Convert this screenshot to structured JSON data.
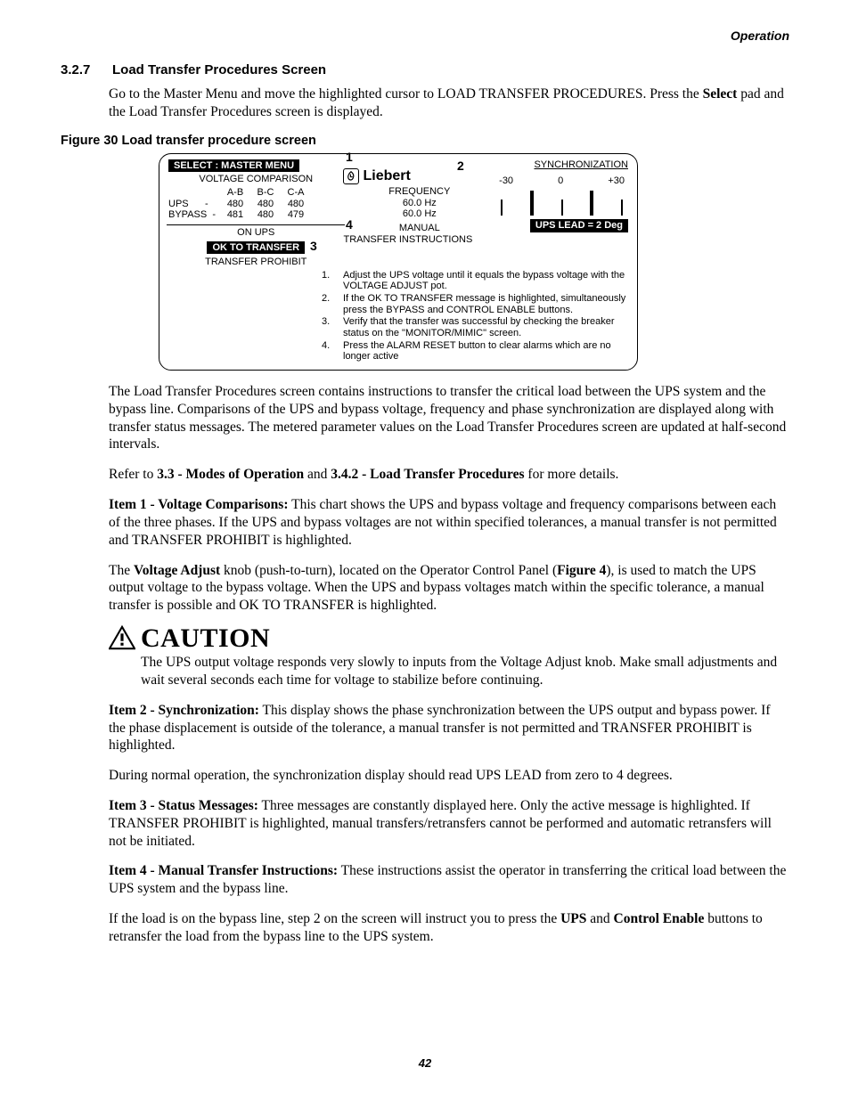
{
  "running_head": "Operation",
  "section": {
    "num": "3.2.7",
    "title": "Load Transfer Procedures Screen"
  },
  "intro": {
    "t1": "Go to the Master Menu and move the highlighted cursor to LOAD TRANSFER PROCEDURES. Press the ",
    "b1": "Select",
    "t2": " pad and the Load Transfer Procedures screen is displayed."
  },
  "fig_caption": "Figure 30  Load transfer procedure screen",
  "panel": {
    "select_bar": "SELECT  :  MASTER MENU",
    "vc_title": "VOLTAGE COMPARISON",
    "vc_headers": [
      "A-B",
      "B-C",
      "C-A"
    ],
    "vc_rows": [
      {
        "label": "UPS",
        "dash": "-",
        "vals": [
          "480",
          "480",
          "480"
        ]
      },
      {
        "label": "BYPASS",
        "dash": "-",
        "vals": [
          "481",
          "480",
          "479"
        ]
      }
    ],
    "on_ups": "ON UPS",
    "ok_transfer": "OK  TO  TRANSFER",
    "transfer_prohibit": "TRANSFER PROHIBIT",
    "logo": "Liebert",
    "freq_title": "FREQUENCY",
    "freq_vals": [
      "60.0 Hz",
      "60.0 Hz"
    ],
    "manual": "MANUAL",
    "trans_instr": "TRANSFER INSTRUCTIONS",
    "sync_title": "SYNCHRONIZATION",
    "sync_scale": [
      "-30",
      "0",
      "+30"
    ],
    "ups_lead": "UPS  LEAD    =    2 Deg",
    "instructions": [
      "Adjust the UPS voltage until it equals the bypass voltage with the VOLTAGE ADJUST pot.",
      "If the OK TO TRANSFER message is highlighted, simultaneously press the BYPASS  and CONTROL ENABLE buttons.",
      "Verify that the transfer was successful by checking the  breaker status on the \"MONITOR/MIMIC\" screen.",
      "Press the ALARM RESET button to clear alarms which are no longer active"
    ],
    "callouts": [
      "1",
      "2",
      "3",
      "4"
    ]
  },
  "paras": {
    "p1": "The Load Transfer Procedures screen contains instructions to transfer the critical load between the UPS system and the bypass line. Comparisons of the UPS and bypass voltage, frequency and phase synchronization are displayed along with transfer status messages. The metered parameter values on the Load Transfer Procedures screen are updated at half-second intervals.",
    "p2a": "Refer to ",
    "p2b1": "3.3 - Modes of Operation",
    "p2c": " and ",
    "p2b2": "3.4.2 - Load Transfer Procedures",
    "p2d": " for more details.",
    "p3b": "Item 1 - Voltage Comparisons:",
    "p3": " This chart shows the UPS and bypass voltage and frequency comparisons between each of the three phases. If the UPS and bypass voltages are not within specified tolerances, a manual transfer is not permitted and TRANSFER PROHIBIT is highlighted.",
    "p4a": "The ",
    "p4b1": "Voltage Adjust",
    "p4c": " knob (push-to-turn), located on the Operator Control Panel (",
    "p4b2": "Figure 4",
    "p4d": "), is used to match the UPS output voltage to the bypass voltage. When the UPS and bypass voltages match within the specific tolerance, a manual transfer is possible and OK TO TRANSFER is highlighted.",
    "caution_word": "CAUTION",
    "caution_body": "The UPS output voltage responds very slowly to inputs from the Voltage Adjust knob. Make small adjustments and wait several seconds each time for voltage to stabilize before continuing.",
    "p5b": "Item 2 - Synchronization:",
    "p5": " This display shows the phase synchronization between the UPS output and bypass power. If the phase displacement is outside of the tolerance, a manual transfer is not permitted and TRANSFER PROHIBIT is highlighted.",
    "p6": "During normal operation, the synchronization display should read UPS LEAD from zero to 4 degrees.",
    "p7b": "Item 3 - Status Messages:",
    "p7": " Three messages are constantly displayed here. Only the active message is highlighted. If TRANSFER PROHIBIT is highlighted, manual transfers/retransfers cannot be performed and automatic retransfers will not be initiated.",
    "p8b": "Item 4 - Manual Transfer Instructions:",
    "p8": " These instructions assist the operator in transferring the critical load between the UPS system and the bypass line.",
    "p9a": "If the load is on the bypass line, step 2 on the screen will instruct you to press the ",
    "p9b1": "UPS",
    "p9c": " and ",
    "p9b2": "Control Enable",
    "p9d": " buttons to retransfer the load from the bypass line to the UPS system."
  },
  "page_num": "42"
}
